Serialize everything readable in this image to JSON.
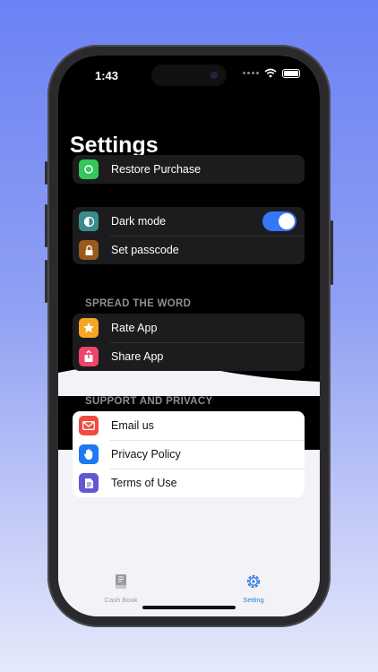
{
  "status_bar": {
    "time": "1:43"
  },
  "header": {
    "title": "Settings"
  },
  "groups": {
    "purchase": {
      "items": [
        {
          "label": "Restore Purchase",
          "icon": "refresh-icon",
          "color": "#34c759"
        }
      ]
    },
    "appearance": {
      "items": [
        {
          "label": "Dark mode",
          "icon": "contrast-icon",
          "color": "#3a8c8c",
          "toggle_on": true
        },
        {
          "label": "Set passcode",
          "icon": "lock-icon",
          "color": "#9a5a1c"
        }
      ]
    },
    "spread": {
      "title": "SPREAD THE WORD",
      "items": [
        {
          "label": "Rate App",
          "icon": "star-icon",
          "color": "#f5a623"
        },
        {
          "label": "Share App",
          "icon": "share-icon",
          "color": "#f0456a"
        }
      ]
    },
    "support": {
      "title": "SUPPORT AND PRIVACY",
      "items": [
        {
          "label": "Email us",
          "icon": "envelope-icon",
          "color": "#ef4b3e"
        },
        {
          "label": "Privacy Policy",
          "icon": "hand-icon",
          "color": "#1e78f0"
        },
        {
          "label": "Terms of Use",
          "icon": "document-icon",
          "color": "#6259d0"
        }
      ]
    }
  },
  "tabbar": {
    "tabs": [
      {
        "label": "Cash Book",
        "icon": "book-icon",
        "active": false
      },
      {
        "label": "Setting",
        "icon": "gear-icon",
        "active": true
      }
    ],
    "active_color": "#2f7de1",
    "inactive_color": "#9a9aa0"
  }
}
